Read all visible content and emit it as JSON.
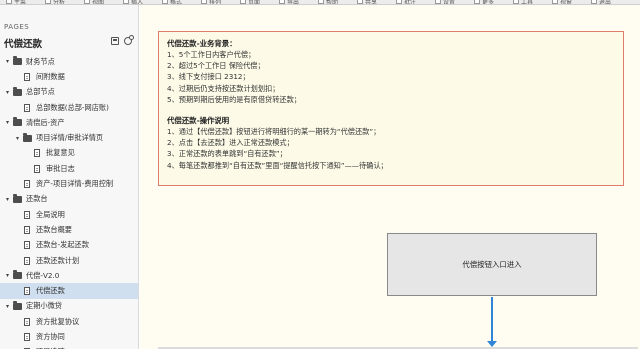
{
  "toolbar": {
    "items": [
      "主菜",
      "分析",
      "视图",
      "插入",
      "格式",
      "排列",
      "页面",
      "导出",
      "帮助",
      "共享",
      "批注",
      "设置",
      "更多",
      "工具",
      "视窗",
      "退出"
    ]
  },
  "sidebar": {
    "pages_label": "PAGES",
    "doc_title": "代偿还款",
    "tree": [
      {
        "type": "folder",
        "level": 0,
        "label": "财务节点",
        "expanded": true
      },
      {
        "type": "page",
        "level": 1,
        "label": "间附数据"
      },
      {
        "type": "folder",
        "level": 0,
        "label": "总部节点",
        "expanded": true
      },
      {
        "type": "page",
        "level": 1,
        "label": "总部数据(总部-网店账)"
      },
      {
        "type": "folder",
        "level": 0,
        "label": "清偿后-资产",
        "expanded": true
      },
      {
        "type": "folder",
        "level": 1,
        "label": "项目详情/审批详情页",
        "expanded": true
      },
      {
        "type": "page",
        "level": 2,
        "label": "批复意见"
      },
      {
        "type": "page",
        "level": 2,
        "label": "审批日志"
      },
      {
        "type": "page",
        "level": 1,
        "label": "资产-项目详情-费用控制"
      },
      {
        "type": "folder",
        "level": 0,
        "label": "还款台",
        "expanded": true
      },
      {
        "type": "page",
        "level": 1,
        "label": "全局说明"
      },
      {
        "type": "page",
        "level": 1,
        "label": "还款台概要"
      },
      {
        "type": "page",
        "level": 1,
        "label": "还款台-发起还款"
      },
      {
        "type": "page",
        "level": 1,
        "label": "还款还款计划"
      },
      {
        "type": "folder",
        "level": 0,
        "label": "代偿-V2.0",
        "expanded": true
      },
      {
        "type": "page",
        "level": 1,
        "label": "代偿还款",
        "selected": true
      },
      {
        "type": "folder",
        "level": 0,
        "label": "定期小微贷",
        "expanded": true
      },
      {
        "type": "page",
        "level": 1,
        "label": "资方批复协议"
      },
      {
        "type": "page",
        "level": 1,
        "label": "资方协同"
      },
      {
        "type": "page",
        "level": 1,
        "label": "项目追踪"
      }
    ]
  },
  "main": {
    "notice": {
      "bg_heading": "代偿还款-业务背景：",
      "bg_lines": [
        "1、5个工作日内客户代偿；",
        "2、超过5个工作日 保险代偿；",
        "3、线下支付接口 2312；",
        "4、过期后仍支持按还款计划划扣；",
        "5、预期到期后使用的是有原借贷转还款；"
      ],
      "op_heading": "代偿还款-操作说明",
      "op_lines": [
        "1、通过【代偿还款】按钮进行将明细行的某一期转为“代偿还款”；",
        "2、点击【去还款】进入正常还款模式；",
        "3、正常还款的表单跳到“自有还款”；",
        "4、每笔还款都推到“自有还款”里面“提醒信托按下通知”——待确认；"
      ]
    },
    "flow_box_label": "代偿按钮入口进入"
  }
}
